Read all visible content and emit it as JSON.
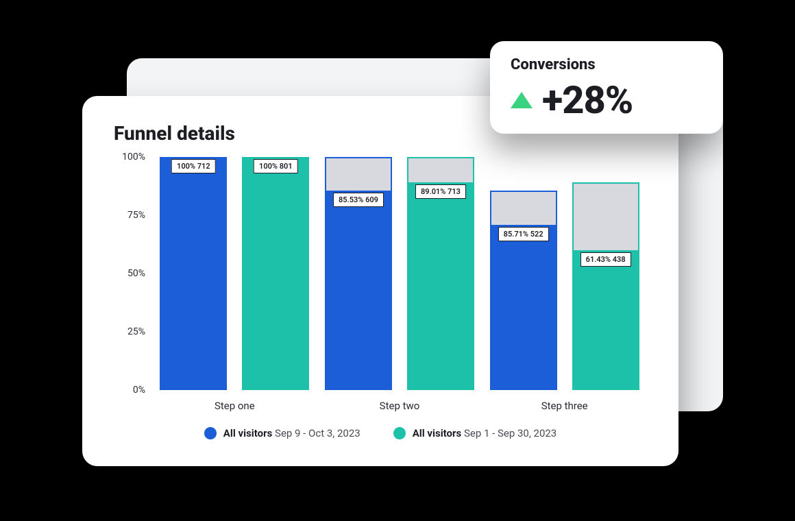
{
  "badge": {
    "title": "Conversions",
    "value": "+28%",
    "direction": "up"
  },
  "card": {
    "title": "Funnel details"
  },
  "legend": {
    "a": {
      "name": "All visitors",
      "range": "Sep 9 - Oct 3, 2023",
      "color": "#1b5ed8"
    },
    "b": {
      "name": "All visitors",
      "range": "Sep 1 - Sep 30, 2023",
      "color": "#1dc0a9"
    }
  },
  "axis": {
    "ticks": [
      "100%",
      "75%",
      "50%",
      "25%",
      "0%"
    ],
    "categories": [
      "Step one",
      "Step two",
      "Step three"
    ]
  },
  "data": {
    "s1a": {
      "outline": 100,
      "fill": 100,
      "label": "100%   712"
    },
    "s1b": {
      "outline": 100,
      "fill": 100,
      "label": "100%   801"
    },
    "s2a": {
      "outline": 100,
      "fill": 85.53,
      "label": "85.53%   609"
    },
    "s2b": {
      "outline": 100,
      "fill": 89.01,
      "label": "89.01%   713"
    },
    "s3a": {
      "outline": 85.71,
      "fill": 71,
      "label": "85.71%   522"
    },
    "s3b": {
      "outline": 89.01,
      "fill": 60,
      "label": "61.43%   438"
    }
  },
  "chart_data": {
    "type": "bar",
    "title": "Funnel details",
    "xlabel": "",
    "ylabel": "",
    "ylim": [
      0,
      100
    ],
    "y_ticks": [
      0,
      25,
      50,
      75,
      100
    ],
    "y_tick_format": "percent",
    "categories": [
      "Step one",
      "Step two",
      "Step three"
    ],
    "series": [
      {
        "name": "All visitors",
        "date_range": "Sep 9 - Oct 3, 2023",
        "color": "#1b5ed8",
        "percent_of_start": [
          100,
          85.53,
          85.71
        ],
        "count": [
          712,
          609,
          522
        ],
        "outline_percent": [
          100,
          100,
          85.71
        ]
      },
      {
        "name": "All visitors",
        "date_range": "Sep 1 - Sep 30, 2023",
        "color": "#1dc0a9",
        "percent_of_start": [
          100,
          89.01,
          61.43
        ],
        "count": [
          801,
          713,
          438
        ],
        "outline_percent": [
          100,
          100,
          89.01
        ]
      }
    ],
    "legend_position": "bottom",
    "grid": false,
    "annotation": {
      "label": "Conversions",
      "value": "+28%",
      "direction": "up"
    }
  }
}
